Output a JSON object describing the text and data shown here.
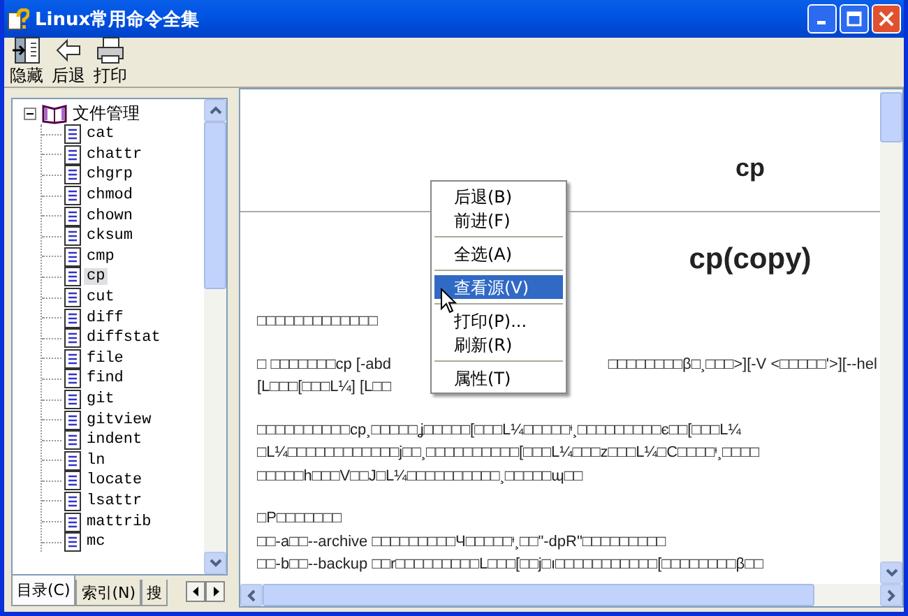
{
  "window": {
    "title": "Linux常用命令全集"
  },
  "toolbar": [
    {
      "label": "隐藏"
    },
    {
      "label": "后退"
    },
    {
      "label": "打印"
    }
  ],
  "tree": {
    "label": "文件管理",
    "expanded": true,
    "children": [
      {
        "label": "cat",
        "selected": false
      },
      {
        "label": "chattr",
        "selected": false
      },
      {
        "label": "chgrp",
        "selected": false
      },
      {
        "label": "chmod",
        "selected": false
      },
      {
        "label": "chown",
        "selected": false
      },
      {
        "label": "cksum",
        "selected": false
      },
      {
        "label": "cmp",
        "selected": false
      },
      {
        "label": "cp",
        "selected": true
      },
      {
        "label": "cut",
        "selected": false
      },
      {
        "label": "diff",
        "selected": false
      },
      {
        "label": "diffstat",
        "selected": false
      },
      {
        "label": "file",
        "selected": false
      },
      {
        "label": "find",
        "selected": false
      },
      {
        "label": "git",
        "selected": false
      },
      {
        "label": "gitview",
        "selected": false
      },
      {
        "label": "indent",
        "selected": false
      },
      {
        "label": "ln",
        "selected": false
      },
      {
        "label": "locate",
        "selected": false
      },
      {
        "label": "lsattr",
        "selected": false
      },
      {
        "label": "mattrib",
        "selected": false
      },
      {
        "label": "mc",
        "selected": false
      }
    ]
  },
  "tabs": [
    {
      "label": "目录(C)",
      "selected": true
    },
    {
      "label": "索引(N)",
      "selected": false
    },
    {
      "label": "搜",
      "selected": false
    }
  ],
  "content": {
    "heading": "cp",
    "title": "cp(copy)",
    "paragraphs": [
      [
        {
          "left": "□□□□□□□□□□□□□"
        }
      ],
      [
        {
          "left": "□    □□□□□□□cp [-abd",
          "right": "□□□□□□□□β□¸□□□>][-V <□□□□□'>][--hel"
        },
        {
          "left": "[L□□□[□□□L¼] [L□□"
        }
      ],
      [
        {
          "left": "□□□□□□□□□□cp¸□□□□□ʝ□□□□□[□□□L¼□□□□□ᶧ¸□□□□□□□□□є□□[□□□L¼"
        },
        {
          "left": "□L¼□□□□□□□□□□□□j□□¸□□□□□□□□□□[□□□L¼□□□z□□□L¼□C□□□□ᶧ¸□□□□"
        },
        {
          "left": "□□□□□h□□□V□□J□L¼□□□□□□□□□□¸□□□□□ɰ□□"
        }
      ],
      [
        {
          "left": "□P□□□□□□□"
        },
        {
          "left": "□□-a□□--archive □□□□□□□□□Ч□□□□□ᶧ¸□□\"-dpR\"□□□□□□□□□"
        },
        {
          "left": "□□-b□□--backup □□r□□□□□□□□□L□□□[□□j□ı□□□□□□□□□□□[□□□□□□□□β□□"
        }
      ]
    ]
  },
  "context_menu": [
    {
      "kind": "item",
      "label": "后退(B)",
      "selected": false
    },
    {
      "kind": "item",
      "label": "前进(F)",
      "selected": false
    },
    {
      "kind": "separator"
    },
    {
      "kind": "item",
      "label": "全选(A)",
      "selected": false
    },
    {
      "kind": "separator"
    },
    {
      "kind": "item",
      "label": "查看源(V)",
      "selected": true
    },
    {
      "kind": "separator"
    },
    {
      "kind": "item",
      "label": "打印(P)...",
      "selected": false
    },
    {
      "kind": "item",
      "label": "刷新(R)",
      "selected": false
    },
    {
      "kind": "separator"
    },
    {
      "kind": "item",
      "label": "属性(T)",
      "selected": false
    }
  ]
}
